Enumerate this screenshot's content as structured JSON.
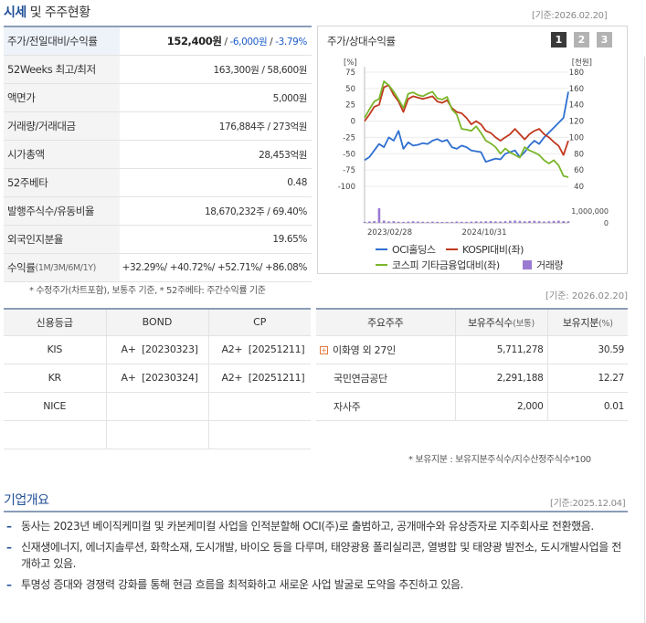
{
  "header": {
    "title_prefix": "시세",
    "title_suffix": "및 주주현황",
    "date": "[기준:2026.02.20]"
  },
  "summary": {
    "rows": [
      {
        "label": "주가/전일대비/수익률",
        "price": "152,400원",
        "sep1": " / ",
        "change": "-6,000원",
        "sep2": " / ",
        "rate": "-3.79%"
      },
      {
        "label": "52Weeks 최고/최저",
        "value": "163,300원 / 58,600원"
      },
      {
        "label": "액면가",
        "value": "5,000원"
      },
      {
        "label": "거래량/거래대금",
        "value": "176,884주 / 273억원"
      },
      {
        "label": "시가총액",
        "value": "28,453억원"
      },
      {
        "label": "52주베타",
        "value": "0.48"
      },
      {
        "label": "발행주식수/유동비율",
        "value": "18,670,232주 / 69.40%"
      },
      {
        "label": "외국인지분율",
        "value": "19.65%"
      }
    ],
    "returns_label": "수익률",
    "returns_period": "(1M/3M/6M/1Y)",
    "returns": [
      "+32.29%",
      "+40.72%",
      "+52.71%",
      "+86.08%"
    ],
    "note": "* 수정주가(차트포함), 보통주 기준, * 52주베타: 주간수익률 기준"
  },
  "chart_panel": {
    "title": "주가/상대수익률",
    "pages": [
      "1",
      "2",
      "3"
    ],
    "active_page": "1",
    "date": "[기준: 2026.02.20]",
    "legend": [
      {
        "name": "OCI홀딩스",
        "color": "#2f6fd0",
        "kind": "line"
      },
      {
        "name": "KOSPI대비(좌)",
        "color": "#c0391f",
        "kind": "line"
      },
      {
        "name": "코스피 기타금융업대비(좌)",
        "color": "#7ab62b",
        "kind": "line"
      },
      {
        "name": "거래량",
        "color": "#9b7bd1",
        "kind": "bar"
      }
    ]
  },
  "chart_data": {
    "type": "line",
    "left_axis": {
      "unit": "[%]",
      "ticks": [
        "75",
        "50",
        "25",
        "0",
        "-25",
        "-50",
        "-75",
        "-100"
      ],
      "ylim": [
        -100,
        75
      ]
    },
    "right_axis": {
      "unit": "[천원]",
      "ticks": [
        "180",
        "160",
        "140",
        "120",
        "100",
        "80",
        "60",
        "40"
      ],
      "ylim": [
        40,
        180
      ]
    },
    "volume_axis": {
      "ticks": [
        "1,000,000",
        "0"
      ],
      "ylim": [
        0,
        1400000
      ]
    },
    "x_ticks": [
      "2023/02/28",
      "2024/10/31"
    ],
    "series": [
      {
        "name": "OCI홀딩스",
        "axis": "right",
        "color": "#2f6fd0",
        "values": [
          72,
          76,
          84,
          92,
          88,
          100,
          96,
          108,
          86,
          94,
          90,
          91,
          93,
          92,
          96,
          98,
          95,
          97,
          88,
          86,
          90,
          88,
          84,
          83,
          82,
          70,
          72,
          74,
          73,
          80,
          82,
          84,
          76,
          82,
          90,
          96,
          92,
          100,
          106,
          112,
          118,
          124,
          156
        ]
      },
      {
        "name": "KOSPI대비(좌)",
        "axis": "left",
        "color": "#c0391f",
        "values": [
          0,
          10,
          22,
          25,
          52,
          55,
          40,
          30,
          14,
          34,
          38,
          36,
          34,
          36,
          38,
          30,
          28,
          32,
          20,
          14,
          12,
          5,
          -5,
          0,
          -5,
          -15,
          -18,
          -25,
          -30,
          -25,
          -20,
          -12,
          -20,
          -28,
          -20,
          -15,
          -12,
          -20,
          -25,
          -32,
          -38,
          -52,
          -30
        ]
      },
      {
        "name": "코스피 기타금융업대비(좌)",
        "axis": "left",
        "color": "#7ab62b",
        "values": [
          5,
          18,
          30,
          34,
          61,
          55,
          45,
          33,
          20,
          42,
          44,
          40,
          38,
          42,
          45,
          35,
          33,
          37,
          18,
          10,
          -12,
          -13,
          -15,
          -8,
          -18,
          -30,
          -34,
          -40,
          -50,
          -42,
          -48,
          -52,
          -56,
          -40,
          -45,
          -48,
          -52,
          -60,
          -65,
          -60,
          -68,
          -84,
          -86
        ]
      },
      {
        "name": "거래량",
        "axis": "volume",
        "color": "#9b7bd1",
        "values": [
          90000,
          120000,
          160000,
          1250000,
          200000,
          130000,
          150000,
          100000,
          90000,
          110000,
          140000,
          120000,
          100000,
          90000,
          110000,
          95000,
          80000,
          85000,
          90000,
          120000,
          100000,
          95000,
          110000,
          130000,
          120000,
          140000,
          160000,
          130000,
          120000,
          150000,
          180000,
          200000,
          170000,
          140000,
          160000,
          180000,
          150000,
          120000,
          140000,
          170000,
          190000,
          160000,
          140000
        ]
      }
    ]
  },
  "credit": {
    "headers": [
      "신용등급",
      "BOND",
      "CP"
    ],
    "rows": [
      {
        "agency": "KIS",
        "bond_grade": "A+",
        "bond_date": "[20230323]",
        "cp_grade": "A2+",
        "cp_date": "[20251211]"
      },
      {
        "agency": "KR",
        "bond_grade": "A+",
        "bond_date": "[20230324]",
        "cp_grade": "A2+",
        "cp_date": "[20251211]"
      },
      {
        "agency": "NICE",
        "bond_grade": "",
        "bond_date": "",
        "cp_grade": "",
        "cp_date": ""
      },
      {
        "agency": "",
        "bond_grade": "",
        "bond_date": "",
        "cp_grade": "",
        "cp_date": ""
      }
    ]
  },
  "holders": {
    "headers": {
      "name": "주요주주",
      "shares": "보유주식수",
      "shares_unit": "(보통)",
      "ratio": "보유지분",
      "ratio_unit": "(%)"
    },
    "rows": [
      {
        "name": "이화영 외 27인",
        "shares": "5,711,278",
        "ratio": "30.59",
        "expandable": true
      },
      {
        "name": "국민연금공단",
        "shares": "2,291,188",
        "ratio": "12.27",
        "expandable": false
      },
      {
        "name": "자사주",
        "shares": "2,000",
        "ratio": "0.01",
        "expandable": false
      }
    ],
    "note": "* 보유지분 : 보유지분주식수/지수산정주식수*100"
  },
  "overview": {
    "title": "기업개요",
    "date": "[기준:2025.12.04]",
    "items": [
      "동사는 2023년 베이직케미컬 및 카본케미컬 사업을 인적분할해 OCI(주)로 출범하고, 공개매수와 유상증자로 지주회사로 전환했음.",
      "신재생에너지, 에너지솔루션, 화학소재, 도시개발, 바이오 등을 다루며, 태양광용 폴리실리콘, 열병합 및 태양광 발전소, 도시개발사업을 전개하고 있음.",
      "투명성 증대와 경쟁력 강화를 통해 현금 흐름을 최적화하고 새로운 사업 발굴로 도약을 추진하고 있음."
    ]
  }
}
